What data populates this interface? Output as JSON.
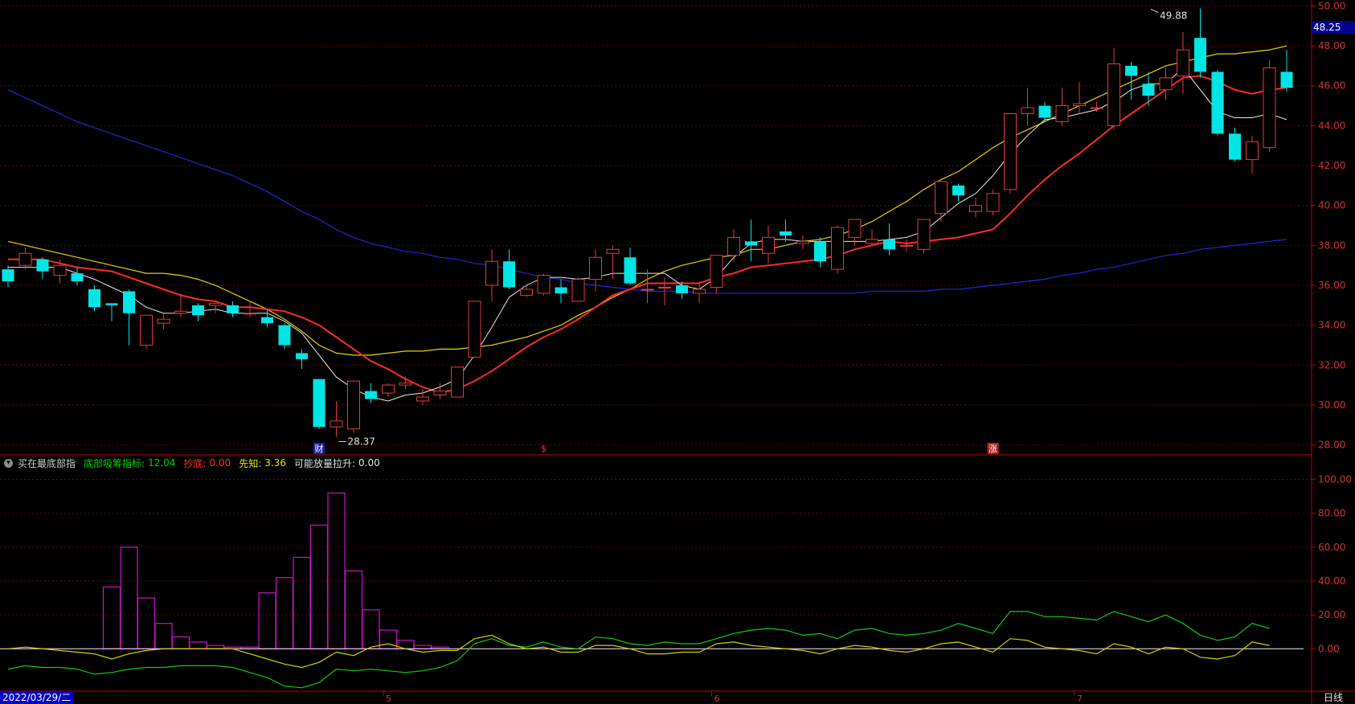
{
  "info_bar": {
    "indicator_name": "买在最底部指",
    "items": [
      {
        "label": "底部吸筹指标:",
        "value": "12.04",
        "color": "#00d200"
      },
      {
        "label": "抄底:",
        "value": "0.00",
        "color": "#ff3030"
      },
      {
        "label": "先知:",
        "value": "3.36",
        "color": "#e6e600"
      },
      {
        "label": "可能放量拉升:",
        "value": "0.00",
        "color": "#e0e0e0"
      }
    ]
  },
  "footer": {
    "date": "2022/03/29/二",
    "period": "日线"
  },
  "current_price_label": "48.25",
  "colors": {
    "up": "#e03c3c",
    "down": "#00e6e6",
    "grid": "#7a0000",
    "axis": "#c80000",
    "ma5": "#e8e8e8",
    "ma10": "#ff2a2a",
    "ma20": "#e6d200",
    "ma60": "#1e28d2",
    "bars": "#c814c8",
    "green_line": "#14c814",
    "yellow_line": "#d2d200",
    "zero_line": "#f0f0f0"
  },
  "chart_data": [
    {
      "type": "candlestick",
      "y_ticks": [
        "28.00",
        "30.00",
        "32.00",
        "34.00",
        "36.00",
        "38.00",
        "40.00",
        "42.00",
        "44.00",
        "46.00",
        "48.00",
        "50.00"
      ],
      "ylim": [
        27.5,
        50.3
      ],
      "annotations": {
        "high": {
          "text": "49.88",
          "value": 49.88,
          "index": 66
        },
        "low": {
          "text": "28.37",
          "value": 28.37,
          "index": 19
        }
      },
      "markers": [
        {
          "text": "财",
          "index": 18,
          "color": "#ffffff",
          "bg": "#1e1eb4"
        },
        {
          "text": "$",
          "index": 31,
          "color": "#ff3030",
          "bg": ""
        },
        {
          "text": "涨",
          "index": 57,
          "color": "#ffffff",
          "bg": "#b41e1e"
        }
      ],
      "month_ticks": [
        {
          "text": "5",
          "index": 22
        },
        {
          "text": "6",
          "index": 41
        },
        {
          "text": "7",
          "index": 62
        }
      ],
      "candles": [
        [
          36.8,
          36.2,
          37.0,
          35.9
        ],
        [
          37.0,
          37.6,
          37.9,
          36.8
        ],
        [
          37.3,
          36.7,
          37.4,
          36.3
        ],
        [
          36.5,
          37.0,
          37.3,
          36.1
        ],
        [
          36.6,
          36.2,
          36.9,
          36.0
        ],
        [
          35.8,
          34.9,
          36.0,
          34.7
        ],
        [
          35.1,
          35.0,
          35.1,
          34.2
        ],
        [
          35.7,
          34.6,
          35.8,
          33.0
        ],
        [
          33.0,
          34.5,
          34.5,
          32.8
        ],
        [
          34.1,
          34.3,
          34.6,
          33.8
        ],
        [
          34.6,
          34.7,
          35.6,
          34.4
        ],
        [
          35.0,
          34.5,
          35.1,
          34.2
        ],
        [
          35.0,
          35.1,
          35.1,
          34.6
        ],
        [
          35.0,
          34.6,
          35.2,
          34.4
        ],
        [
          34.6,
          34.6,
          35.2,
          34.4
        ],
        [
          34.4,
          34.1,
          34.8,
          33.9
        ],
        [
          34.0,
          33.0,
          34.1,
          32.8
        ],
        [
          32.6,
          32.3,
          32.8,
          31.8
        ],
        [
          31.3,
          28.9,
          31.3,
          28.8
        ],
        [
          28.9,
          29.2,
          30.2,
          28.4
        ],
        [
          28.8,
          31.2,
          31.2,
          28.6
        ],
        [
          30.7,
          30.3,
          31.1,
          30.1
        ],
        [
          30.6,
          31.0,
          31.1,
          30.4
        ],
        [
          31.0,
          31.1,
          31.4,
          30.8
        ],
        [
          30.2,
          30.4,
          30.8,
          30.0
        ],
        [
          30.5,
          30.7,
          31.1,
          30.3
        ],
        [
          30.4,
          31.9,
          31.9,
          30.4
        ],
        [
          32.4,
          35.2,
          35.2,
          32.4
        ],
        [
          36.0,
          37.2,
          37.8,
          35.2
        ],
        [
          37.2,
          35.9,
          37.8,
          35.8
        ],
        [
          35.5,
          35.8,
          36.0,
          35.4
        ],
        [
          35.6,
          36.5,
          36.6,
          35.5
        ],
        [
          35.9,
          35.6,
          36.3,
          35.1
        ],
        [
          35.2,
          36.3,
          36.4,
          35.2
        ],
        [
          36.3,
          37.4,
          37.8,
          35.7
        ],
        [
          37.6,
          37.8,
          38.0,
          36.3
        ],
        [
          37.4,
          36.1,
          37.9,
          36.0
        ],
        [
          35.8,
          35.8,
          36.8,
          35.1
        ],
        [
          35.9,
          35.9,
          36.4,
          35.0
        ],
        [
          36.0,
          35.6,
          36.2,
          35.3
        ],
        [
          35.6,
          35.8,
          36.2,
          35.1
        ],
        [
          35.9,
          37.5,
          37.5,
          35.6
        ],
        [
          37.5,
          38.4,
          38.8,
          37.2
        ],
        [
          38.2,
          38.0,
          39.3,
          37.2
        ],
        [
          37.6,
          38.4,
          39.0,
          37.1
        ],
        [
          38.7,
          38.5,
          39.3,
          38.2
        ],
        [
          38.1,
          38.2,
          38.5,
          37.8
        ],
        [
          38.2,
          37.2,
          38.4,
          36.9
        ],
        [
          36.8,
          38.9,
          39.0,
          36.6
        ],
        [
          38.4,
          39.3,
          39.3,
          38.0
        ],
        [
          38.1,
          38.3,
          38.8,
          38.0
        ],
        [
          38.3,
          37.8,
          39.1,
          37.5
        ],
        [
          38.0,
          38.0,
          38.3,
          37.7
        ],
        [
          37.8,
          39.3,
          39.3,
          37.6
        ],
        [
          39.6,
          41.2,
          41.2,
          39.2
        ],
        [
          41.0,
          40.5,
          41.1,
          40.2
        ],
        [
          39.7,
          40.0,
          40.4,
          39.4
        ],
        [
          39.7,
          40.6,
          40.8,
          39.5
        ],
        [
          40.8,
          44.6,
          44.6,
          40.6
        ],
        [
          44.6,
          44.9,
          45.9,
          44.0
        ],
        [
          45.0,
          44.4,
          45.2,
          44.2
        ],
        [
          44.2,
          45.0,
          45.9,
          44.0
        ],
        [
          45.0,
          45.1,
          46.2,
          44.6
        ],
        [
          44.9,
          44.9,
          45.2,
          44.7
        ],
        [
          44.0,
          47.1,
          47.9,
          43.8
        ],
        [
          47.0,
          46.5,
          47.2,
          45.3
        ],
        [
          46.1,
          45.5,
          46.7,
          45.0
        ],
        [
          45.8,
          46.4,
          46.9,
          45.3
        ],
        [
          46.5,
          47.8,
          48.7,
          45.6
        ],
        [
          48.4,
          46.7,
          49.88,
          46.4
        ],
        [
          46.7,
          43.6,
          46.8,
          43.5
        ],
        [
          43.6,
          42.3,
          43.9,
          42.2
        ],
        [
          42.3,
          43.2,
          43.5,
          41.6
        ],
        [
          42.9,
          46.9,
          47.3,
          42.7
        ],
        [
          46.7,
          45.9,
          47.8,
          45.7
        ]
      ],
      "ma5": [
        36.9,
        36.9,
        36.9,
        36.9,
        36.6,
        36.3,
        35.9,
        35.5,
        34.9,
        34.6,
        34.6,
        34.7,
        34.8,
        34.6,
        34.6,
        34.6,
        34.2,
        33.6,
        32.5,
        31.4,
        30.8,
        30.4,
        30.2,
        30.5,
        30.6,
        30.9,
        31.3,
        32.5,
        33.9,
        35.4,
        36.0,
        36.4,
        36.4,
        36.3,
        36.4,
        36.6,
        36.6,
        36.6,
        36.6,
        36.0,
        35.8,
        36.4,
        37.4,
        38.1,
        38.3,
        38.3,
        38.2,
        38.2,
        38.2,
        38.2,
        38.2,
        38.3,
        38.4,
        38.7,
        39.4,
        40.1,
        40.6,
        41.5,
        42.6,
        43.5,
        44.3,
        44.4,
        44.6,
        44.8,
        45.2,
        45.8,
        46.1,
        46.1,
        46.9,
        45.8,
        44.7,
        44.4,
        44.4,
        44.6,
        44.3
      ],
      "ma10": [
        37.3,
        37.3,
        37.3,
        37.1,
        36.9,
        36.8,
        36.7,
        36.4,
        36.1,
        35.8,
        35.5,
        35.3,
        35.2,
        34.9,
        34.9,
        34.8,
        34.7,
        34.4,
        34.0,
        33.4,
        32.8,
        32.2,
        31.8,
        31.3,
        30.9,
        30.6,
        30.8,
        31.2,
        31.7,
        32.3,
        32.9,
        33.4,
        33.8,
        34.3,
        34.9,
        35.5,
        35.8,
        36.1,
        36.1,
        36.1,
        36.1,
        36.4,
        36.6,
        36.9,
        37.0,
        37.1,
        37.2,
        37.3,
        37.5,
        37.8,
        38.0,
        38.2,
        38.1,
        38.2,
        38.3,
        38.4,
        38.6,
        38.8,
        39.6,
        40.5,
        41.3,
        42.0,
        42.6,
        43.3,
        44.0,
        44.6,
        45.2,
        45.8,
        46.4,
        46.5,
        46.2,
        45.8,
        45.6,
        45.8,
        45.9
      ],
      "ma20": [
        38.2,
        38.0,
        37.8,
        37.6,
        37.4,
        37.2,
        37.0,
        36.8,
        36.6,
        36.6,
        36.5,
        36.3,
        36.0,
        35.6,
        35.2,
        34.8,
        34.3,
        33.7,
        33.0,
        32.6,
        32.5,
        32.5,
        32.6,
        32.7,
        32.7,
        32.8,
        32.8,
        32.9,
        33.0,
        33.2,
        33.4,
        33.7,
        34.0,
        34.5,
        34.9,
        35.4,
        35.8,
        36.3,
        36.7,
        37.0,
        37.2,
        37.4,
        37.5,
        37.8,
        37.8,
        38.0,
        38.2,
        38.3,
        38.5,
        38.8,
        39.2,
        39.7,
        40.2,
        40.8,
        41.3,
        41.7,
        42.3,
        42.9,
        43.4,
        43.8,
        44.2,
        44.6,
        45.0,
        45.4,
        45.8,
        46.2,
        46.6,
        47.0,
        47.2,
        47.4,
        47.6,
        47.6,
        47.7,
        47.8,
        48.0
      ],
      "ma60": [
        45.8,
        45.4,
        45.0,
        44.6,
        44.2,
        43.9,
        43.6,
        43.3,
        43.0,
        42.7,
        42.4,
        42.1,
        41.8,
        41.5,
        41.1,
        40.7,
        40.2,
        39.7,
        39.3,
        38.8,
        38.4,
        38.1,
        37.9,
        37.7,
        37.6,
        37.4,
        37.3,
        37.1,
        37.0,
        36.8,
        36.6,
        36.4,
        36.3,
        36.1,
        36.0,
        35.9,
        35.8,
        35.7,
        35.7,
        35.7,
        35.6,
        35.6,
        35.6,
        35.6,
        35.6,
        35.6,
        35.6,
        35.6,
        35.6,
        35.6,
        35.7,
        35.7,
        35.7,
        35.7,
        35.8,
        35.8,
        35.9,
        36.0,
        36.1,
        36.2,
        36.3,
        36.5,
        36.6,
        36.8,
        36.9,
        37.1,
        37.3,
        37.5,
        37.6,
        37.8,
        37.9,
        38.0,
        38.1,
        38.2,
        38.3
      ]
    },
    {
      "type": "bar+line",
      "y_ticks": [
        "0.00",
        "20.00",
        "40.00",
        "60.00",
        "80.00",
        "100.00"
      ],
      "ylim": [
        -25,
        105
      ],
      "bars": [
        [
          6,
          36.5
        ],
        [
          7,
          60
        ],
        [
          8,
          30
        ],
        [
          9,
          15
        ],
        [
          10,
          7
        ],
        [
          11,
          4
        ],
        [
          12,
          2
        ],
        [
          13,
          1
        ],
        [
          14,
          1
        ],
        [
          15,
          33
        ],
        [
          16,
          42
        ],
        [
          17,
          54
        ],
        [
          18,
          73
        ],
        [
          19,
          92
        ],
        [
          20,
          46
        ],
        [
          21,
          23
        ],
        [
          22,
          11
        ],
        [
          23,
          5
        ],
        [
          24,
          2
        ],
        [
          25,
          1
        ]
      ],
      "green": [
        -12,
        -10,
        -11,
        -11,
        -12,
        -15,
        -14,
        -12,
        -11,
        -11,
        -10,
        -10,
        -10,
        -11,
        -14,
        -17,
        -22,
        -23,
        -20,
        -12,
        -13,
        -12,
        -13,
        -14,
        -13,
        -11,
        -7,
        3,
        6,
        2,
        1,
        4,
        1,
        0,
        7,
        6,
        3,
        2,
        4,
        3,
        3,
        6,
        9,
        11,
        12,
        11,
        8,
        9,
        6,
        11,
        12,
        9,
        8,
        9,
        11,
        15,
        12,
        9,
        22,
        22,
        19,
        19,
        18,
        17,
        22,
        19,
        16,
        20,
        15,
        8,
        5,
        7,
        15,
        12
      ],
      "yellow": [
        0,
        1,
        0,
        -1,
        -2,
        -3,
        -6,
        -3,
        -1,
        0,
        0,
        0,
        0,
        0,
        -3,
        -6,
        -9,
        -11,
        -8,
        -2,
        -4,
        1,
        3,
        0,
        -2,
        -1,
        -1,
        6,
        8,
        3,
        0,
        1,
        -2,
        -2,
        2,
        2,
        0,
        -3,
        -3,
        -2,
        -2,
        3,
        4,
        2,
        1,
        0,
        -1,
        -3,
        0,
        2,
        1,
        -1,
        -2,
        0,
        3,
        4,
        1,
        -2,
        6,
        5,
        1,
        0,
        -1,
        -3,
        3,
        1,
        -3,
        1,
        0,
        -5,
        -6,
        -4,
        4,
        2
      ]
    }
  ]
}
